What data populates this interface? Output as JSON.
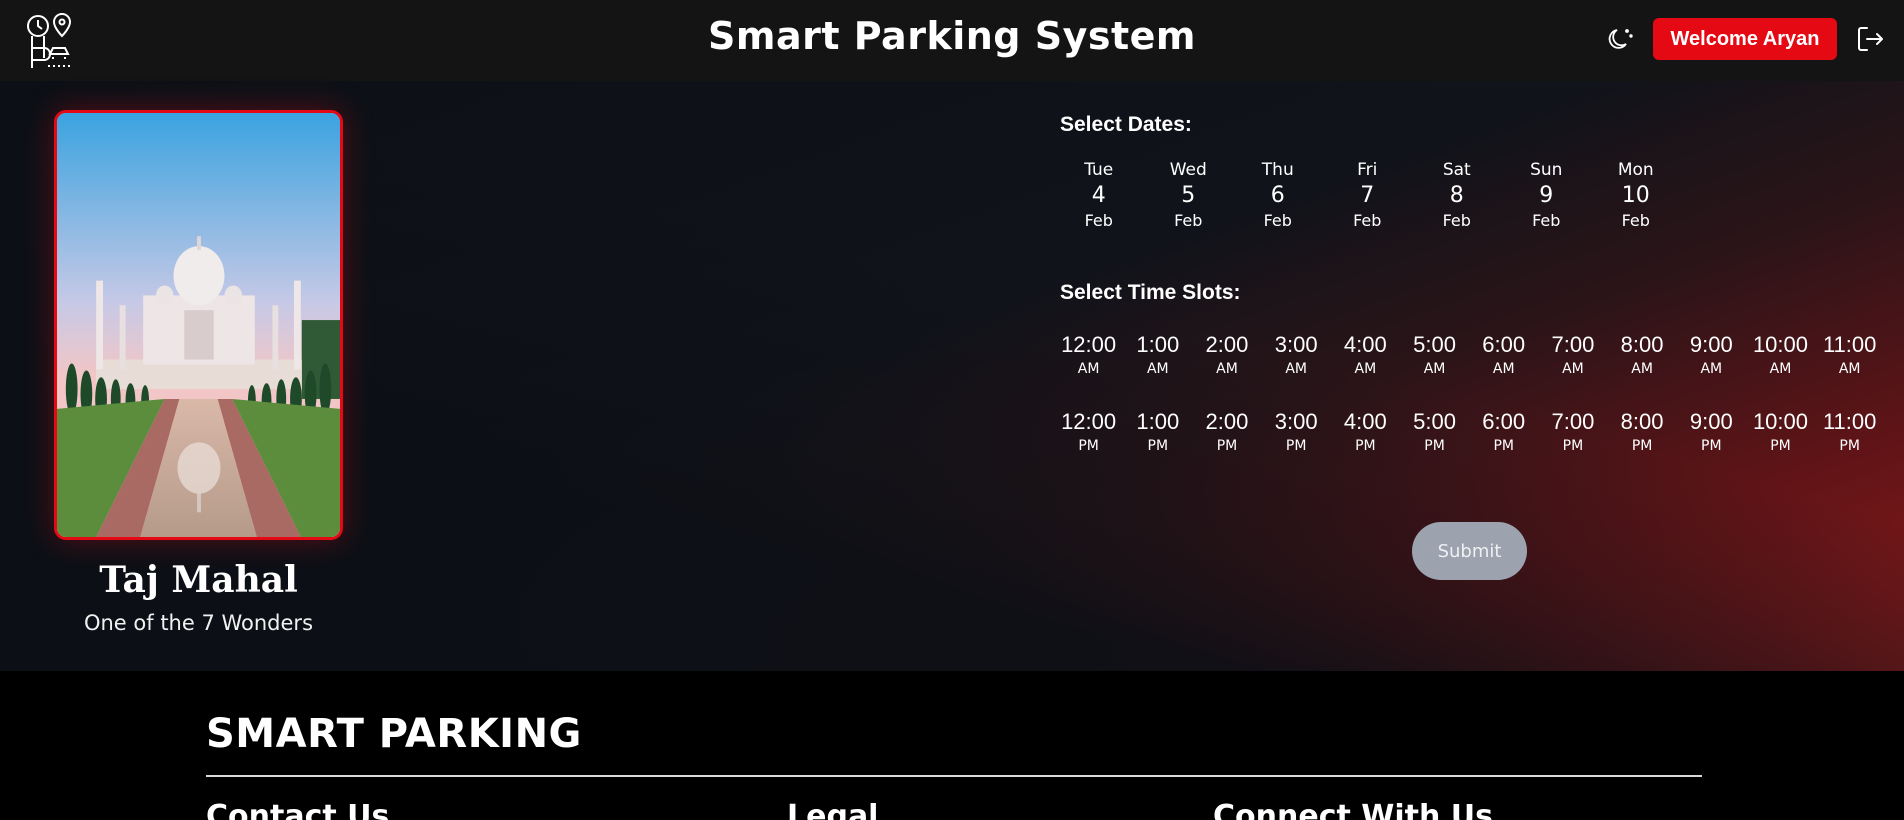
{
  "header": {
    "title": "Smart Parking System",
    "welcome_label": "Welcome Aryan",
    "icons": [
      "parking-logo-icon",
      "moon-icon",
      "logout-icon"
    ]
  },
  "place": {
    "name": "Taj Mahal",
    "subtitle": "One of the 7 Wonders"
  },
  "dates": {
    "label": "Select Dates:",
    "items": [
      {
        "day": "Tue",
        "num": "4",
        "month": "Feb"
      },
      {
        "day": "Wed",
        "num": "5",
        "month": "Feb"
      },
      {
        "day": "Thu",
        "num": "6",
        "month": "Feb"
      },
      {
        "day": "Fri",
        "num": "7",
        "month": "Feb"
      },
      {
        "day": "Sat",
        "num": "8",
        "month": "Feb"
      },
      {
        "day": "Sun",
        "num": "9",
        "month": "Feb"
      },
      {
        "day": "Mon",
        "num": "10",
        "month": "Feb"
      }
    ]
  },
  "slots": {
    "label": "Select Time Slots:",
    "am": [
      {
        "time": "12:00",
        "period": "AM"
      },
      {
        "time": "1:00",
        "period": "AM"
      },
      {
        "time": "2:00",
        "period": "AM"
      },
      {
        "time": "3:00",
        "period": "AM"
      },
      {
        "time": "4:00",
        "period": "AM"
      },
      {
        "time": "5:00",
        "period": "AM"
      },
      {
        "time": "6:00",
        "period": "AM"
      },
      {
        "time": "7:00",
        "period": "AM"
      },
      {
        "time": "8:00",
        "period": "AM"
      },
      {
        "time": "9:00",
        "period": "AM"
      },
      {
        "time": "10:00",
        "period": "AM"
      },
      {
        "time": "11:00",
        "period": "AM"
      }
    ],
    "pm": [
      {
        "time": "12:00",
        "period": "PM"
      },
      {
        "time": "1:00",
        "period": "PM"
      },
      {
        "time": "2:00",
        "period": "PM"
      },
      {
        "time": "3:00",
        "period": "PM"
      },
      {
        "time": "4:00",
        "period": "PM"
      },
      {
        "time": "5:00",
        "period": "PM"
      },
      {
        "time": "6:00",
        "period": "PM"
      },
      {
        "time": "7:00",
        "period": "PM"
      },
      {
        "time": "8:00",
        "period": "PM"
      },
      {
        "time": "9:00",
        "period": "PM"
      },
      {
        "time": "10:00",
        "period": "PM"
      },
      {
        "time": "11:00",
        "period": "PM"
      }
    ]
  },
  "submit_label": "Submit",
  "footer": {
    "brand": "SMART PARKING",
    "columns": [
      "Contact Us",
      "Legal",
      "Connect With Us"
    ]
  },
  "colors": {
    "accent": "#e50914",
    "header_bg": "#141414",
    "submit_disabled": "#9ca3af"
  }
}
